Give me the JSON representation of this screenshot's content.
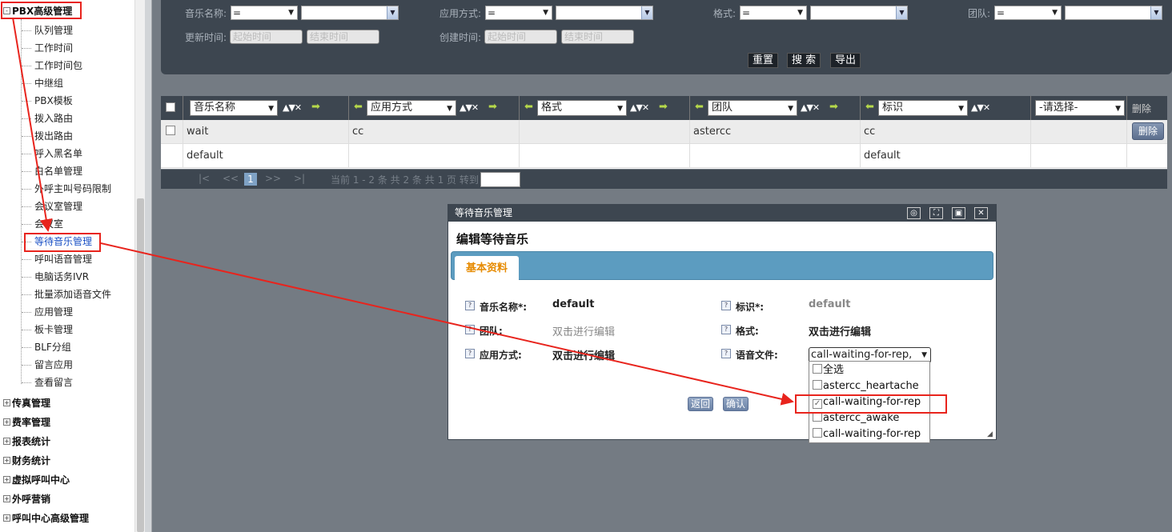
{
  "sidebar": {
    "root_open": "PBX高级管理",
    "children": [
      "队列管理",
      "工作时间",
      "工作时间包",
      "中继组",
      "PBX模板",
      "拨入路由",
      "拨出路由",
      "呼入黑名单",
      "白名单管理",
      "外呼主叫号码限制",
      "会议室管理",
      "会议室",
      "等待音乐管理",
      "呼叫语音管理",
      "电脑话务IVR",
      "批量添加语音文件",
      "应用管理",
      "板卡管理",
      "BLF分组",
      "留言应用",
      "查看留言"
    ],
    "active_child_index": 12,
    "collapsed_roots": [
      "传真管理",
      "费率管理",
      "报表统计",
      "财务统计",
      "虚拟呼叫中心",
      "外呼营销",
      "呼叫中心高级管理"
    ],
    "expand_symbol": "+",
    "collapse_symbol": "-"
  },
  "search": {
    "music_name_label": "音乐名称:",
    "app_mode_label": "应用方式:",
    "format_label": "格式:",
    "team_label": "团队:",
    "update_time_label": "更新时间:",
    "create_time_label": "创建时间:",
    "operator": "=",
    "start_placeholder": "起始时间",
    "end_placeholder": "结束时间",
    "reset_btn": "重置",
    "search_btn": "搜 索",
    "export_btn": "导出"
  },
  "grid": {
    "columns": [
      "音乐名称",
      "应用方式",
      "格式",
      "团队",
      "标识"
    ],
    "choose_placeholder": "-请选择-",
    "delete_header": "删除",
    "rows": [
      {
        "name": "wait",
        "mode": "cc",
        "format": "",
        "team": "astercc",
        "tag": "cc",
        "delete": "删除"
      },
      {
        "name": "default",
        "mode": "",
        "format": "",
        "team": "",
        "tag": "default",
        "delete": ""
      }
    ]
  },
  "pager": {
    "first": "|<",
    "prev": "<<",
    "current": "1",
    "next": ">>",
    "last": ">|",
    "summary": "当前 1 - 2 条 共 2 条 共 1 页 转到"
  },
  "dialog": {
    "title": "等待音乐管理",
    "heading": "编辑等待音乐",
    "tab": "基本资料",
    "fields": {
      "music_name_label": "音乐名称*:",
      "music_name_value": "default",
      "tag_label": "标识*:",
      "tag_value": "default",
      "team_label": "团队:",
      "team_value": "双击进行编辑",
      "format_label": "格式:",
      "format_value": "双击进行编辑",
      "app_mode_label": "应用方式:",
      "app_mode_value": "双击进行编辑",
      "audio_label": "语音文件:",
      "audio_value": "call-waiting-for-rep,"
    },
    "back_btn": "返回",
    "confirm_btn": "确认",
    "audio_options": [
      {
        "label": "全选",
        "checked": false
      },
      {
        "label": "astercc_heartache",
        "checked": false
      },
      {
        "label": "call-waiting-for-rep",
        "checked": true
      },
      {
        "label": "astercc_awake",
        "checked": false
      },
      {
        "label": "call-waiting-for-rep",
        "checked": false
      }
    ]
  },
  "colors": {
    "annotation": "#e8241d",
    "panel_dark": "#3d4650",
    "tab_bar": "#5c9cc0",
    "tab_label": "#e68a00",
    "active_link": "#1a4fc4"
  }
}
